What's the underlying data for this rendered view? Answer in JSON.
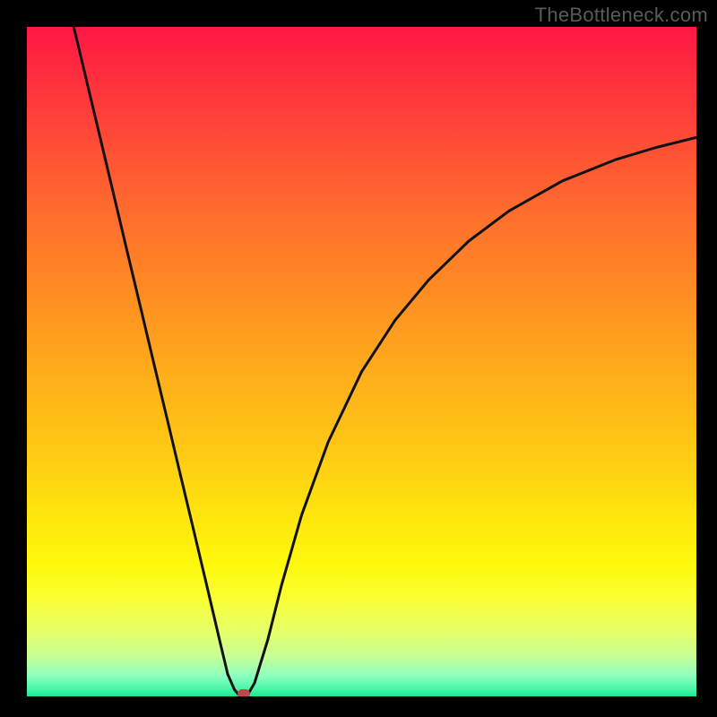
{
  "watermark": "TheBottleneck.com",
  "colors": {
    "page_bg": "#000000",
    "watermark": "#5a5a5a",
    "curve_stroke": "#111111",
    "marker": "#b84a4a",
    "gradient_top": "#ff1744",
    "gradient_bottom": "#19e78e"
  },
  "chart_data": {
    "type": "line",
    "title": "",
    "xlabel": "",
    "ylabel": "",
    "xlim": [
      0,
      1
    ],
    "ylim": [
      0,
      1
    ],
    "x": [
      0.07,
      0.09,
      0.11,
      0.13,
      0.15,
      0.17,
      0.19,
      0.21,
      0.23,
      0.25,
      0.27,
      0.29,
      0.3,
      0.31,
      0.317,
      0.324,
      0.33,
      0.34,
      0.36,
      0.38,
      0.41,
      0.45,
      0.5,
      0.55,
      0.6,
      0.66,
      0.72,
      0.8,
      0.88,
      0.94,
      1.0
    ],
    "values": [
      1.0,
      0.916,
      0.832,
      0.748,
      0.664,
      0.58,
      0.496,
      0.412,
      0.328,
      0.244,
      0.16,
      0.075,
      0.033,
      0.01,
      0.002,
      0.0,
      0.003,
      0.02,
      0.085,
      0.165,
      0.27,
      0.38,
      0.485,
      0.562,
      0.622,
      0.68,
      0.725,
      0.77,
      0.802,
      0.82,
      0.835
    ],
    "marker": {
      "x": 0.324,
      "y": 0.0
    },
    "grid": false,
    "legend": false
  }
}
